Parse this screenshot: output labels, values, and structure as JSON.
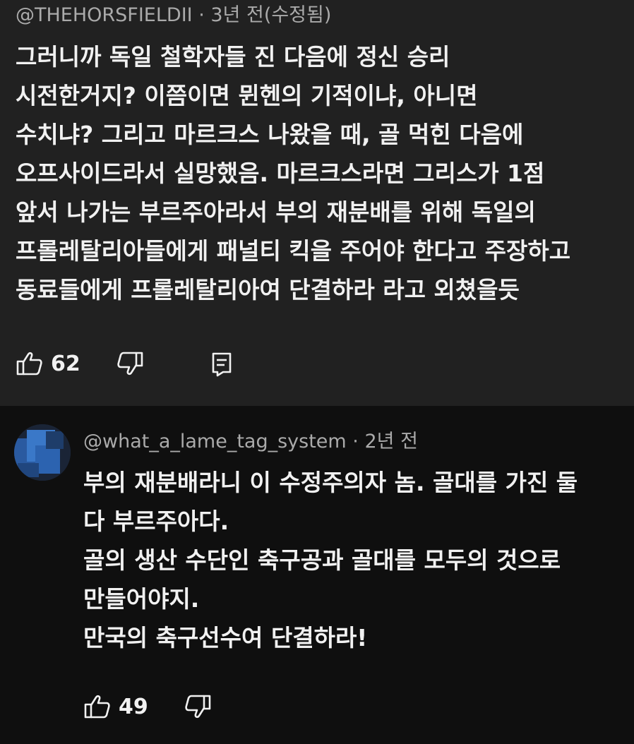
{
  "comment1": {
    "author": "@THEHORSFIELDII",
    "meta": " · 3년 전(수정됨)",
    "lines": [
      "그러니까 독일 철학자들 진 다음에 정신 승리",
      "시전한거지? 이쯤이면 뮌헨의 기적이냐, 아니면",
      "수치냐? 그리고 마르크스 나왔을 때, 골 먹힌 다음에",
      "오프사이드라서 실망했음. 마르크스라면 그리스가 1점",
      "앞서 나가는 부르주아라서 부의 재분배를 위해 독일의",
      "프롤레탈리아들에게 패널티 킥을 주어야 한다고 주장하고",
      "동료들에게 프롤레탈리아여 단결하라 라고 외쳤을듯"
    ],
    "likes": "62",
    "icons": {
      "like": "thumbs-up-icon",
      "dislike": "thumbs-down-icon",
      "reply": "reply-icon"
    }
  },
  "comment2": {
    "author": "@what_a_lame_tag_system",
    "meta": " · 2년 전",
    "lines": [
      "부의 재분배라니 이 수정주의자 놈. 골대를 가진 둘",
      "다 부르주아다.",
      "골의 생산 수단인 축구공과 골대를 모두의 것으로",
      "만들어야지.",
      "만국의 축구선수여 단결하라!"
    ],
    "likes": "49",
    "icons": {
      "avatar": "avatar",
      "like": "thumbs-up-icon",
      "dislike": "thumbs-down-icon"
    }
  },
  "colors": {
    "top_bg": "#212121",
    "bottom_bg": "#0f0f0f",
    "text": "#f1f1f1",
    "meta": "#aaaaaa"
  }
}
